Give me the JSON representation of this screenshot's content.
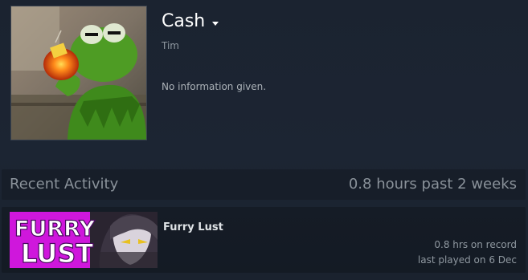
{
  "profile": {
    "name": "Cash",
    "real_name": "Tim",
    "summary": "No information given."
  },
  "recent_activity": {
    "title": "Recent Activity",
    "total_playtime": "0.8 hours past 2 weeks",
    "games": [
      {
        "name": "Furry Lust",
        "capsule_text_line1": "FURRY",
        "capsule_text_line2": "LUST",
        "hours_on_record": "0.8 hrs on record",
        "last_played": "last played on 6 Dec"
      }
    ]
  },
  "colors": {
    "background": "#1b2330",
    "text_primary": "#ffffff",
    "text_muted": "#8f98a0",
    "capsule_magenta": "#d21ae0"
  },
  "icons": {
    "caret": "chevron-down-icon"
  }
}
